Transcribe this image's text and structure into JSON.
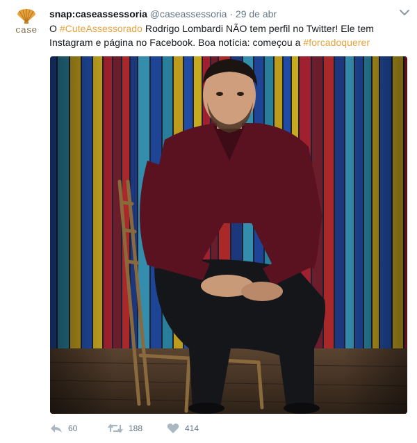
{
  "account": {
    "display_name": "snap:caseassessoria",
    "handle": "@caseassessoria",
    "separator": "·",
    "timestamp": "29 de abr",
    "avatar_text": "case"
  },
  "tweet": {
    "prefix": "O ",
    "hashtag1": "#CuteAssessorado",
    "middle": " Rodrigo Lombardi NÃO tem perfil no Twitter! Ele tem Instagram e página no Facebook. Boa notícia: começou a ",
    "hashtag2": "#forcadoquerer"
  },
  "actions": {
    "replies": "60",
    "retweets": "188",
    "likes": "414"
  },
  "icons": {
    "menu": "chevron-down-icon",
    "reply": "reply-icon",
    "retweet": "retweet-icon",
    "like": "heart-icon"
  },
  "colors": {
    "hashtag": "#e8a23a",
    "meta": "#657786",
    "brand_gold": "#d9942c"
  }
}
